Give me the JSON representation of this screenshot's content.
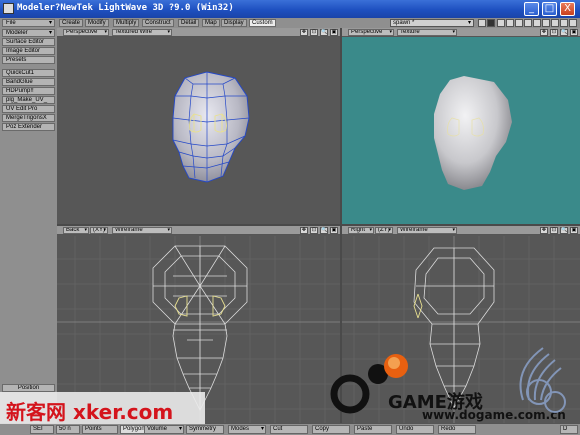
{
  "window": {
    "title": "Modeler?NewTek LightWave 3D ?9.0 (Win32)",
    "controls": [
      "_",
      "□",
      "X"
    ]
  },
  "left_panel": {
    "items": [
      {
        "label": "File",
        "dropdown": true
      },
      {
        "label": "Modeler",
        "dropdown": true
      },
      {
        "label": "Surface Editor"
      },
      {
        "label": "Image Editor"
      },
      {
        "label": "Presets"
      },
      {
        "label": "QuickCut1"
      },
      {
        "label": "BandGlue"
      },
      {
        "label": "HDPump!!"
      },
      {
        "label": "plg_Make_UV_"
      },
      {
        "label": "UV Edit Pro"
      },
      {
        "label": "MergeTrigonsX"
      },
      {
        "label": "Poz Extender"
      }
    ],
    "position_label": "Position"
  },
  "tabs": [
    {
      "label": "Create"
    },
    {
      "label": "Modify"
    },
    {
      "label": "Multiply"
    },
    {
      "label": "Construct"
    },
    {
      "label": "Detail"
    },
    {
      "label": "Map"
    },
    {
      "label": "Display"
    },
    {
      "label": "Custom",
      "active": true
    }
  ],
  "layer_select": {
    "value": "spawn *"
  },
  "viewports": {
    "top_left": {
      "view": "Perspective",
      "mode": "Textured Wire",
      "icons": [
        "✥",
        "⊡",
        "🔍",
        "▣"
      ]
    },
    "top_right": {
      "view": "Perspective",
      "mode": "Texture",
      "icons": [
        "✥",
        "⊡",
        "🔍",
        "▣"
      ]
    },
    "bottom_left": {
      "view": "Back",
      "axes": "(XY)",
      "mode": "Wireframe",
      "icons": [
        "✥",
        "⊡",
        "🔍",
        "▣"
      ]
    },
    "bottom_right": {
      "view": "Right",
      "axes": "(ZY)",
      "mode": "Wireframe",
      "icons": [
        "✥",
        "⊡",
        "🔍",
        "▣"
      ]
    }
  },
  "bottom_bar": {
    "left_value": "SEI",
    "grid_value": "50 n",
    "points": "Points",
    "polygons": "Polygons",
    "volume": "Volume",
    "symmetry": "Symmetry",
    "modes": "Modes",
    "cut": "Cut",
    "copy": "Copy",
    "paste": "Paste",
    "undo": "Undo",
    "redo": "Redo",
    "d_label": "D"
  },
  "watermarks": {
    "left": "新客网 xker.com",
    "game_brand": "GAME游戏",
    "site": "www.dogame.com.cn"
  },
  "colors": {
    "viewport_gray": "#575757",
    "texture_teal": "#3a8a8a",
    "wire_blue": "#2448c8",
    "wire_white": "#dcdcdc",
    "wire_yellow": "#e8e090",
    "active_tab": "#ececec"
  }
}
